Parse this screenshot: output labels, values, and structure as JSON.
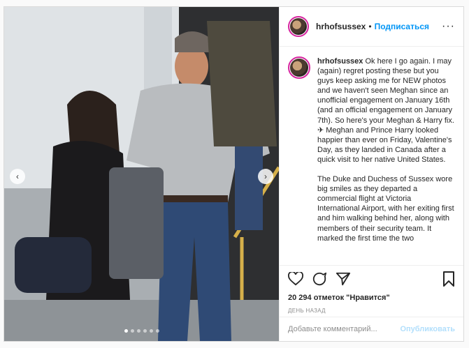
{
  "post": {
    "username": "hrhofsussex",
    "separator": "•",
    "follow_label": "Подписаться",
    "more_label": "···",
    "caption_paragraphs": [
      "Ok here I go again. I may (again) regret posting these but you guys keep asking me for NEW photos and we haven't seen Meghan since an unofficial engagement on January 16th (and an official engagement on January 7th). So here's your Meghan & Harry fix. ✈ Meghan and Prince Harry looked happier than ever on Friday, Valentine's Day, as they landed in Canada after a quick visit to her native United States.",
      "The Duke and Duchess of Sussex wore big smiles as they departed a commercial flight at Victoria International Airport, with her exiting first and him walking behind her, along with members of their security team. It marked the first time the two"
    ],
    "likes_text": "20 294 отметок \"Нравится\"",
    "time_text": "день назад",
    "comment_placeholder": "Добавьте комментарий...",
    "publish_label": "Опубликовать"
  },
  "carousel": {
    "prev_label": "‹",
    "next_label": "›",
    "dot_count": 6,
    "active_dot": 0
  },
  "colors": {
    "accent": "#0095f6",
    "publish_disabled": "#b2dffc",
    "story_ring": "#d6249f"
  },
  "icons": [
    "heart-icon",
    "comment-icon",
    "share-icon",
    "bookmark-icon",
    "more-icon",
    "chevron-left-icon",
    "chevron-right-icon"
  ]
}
